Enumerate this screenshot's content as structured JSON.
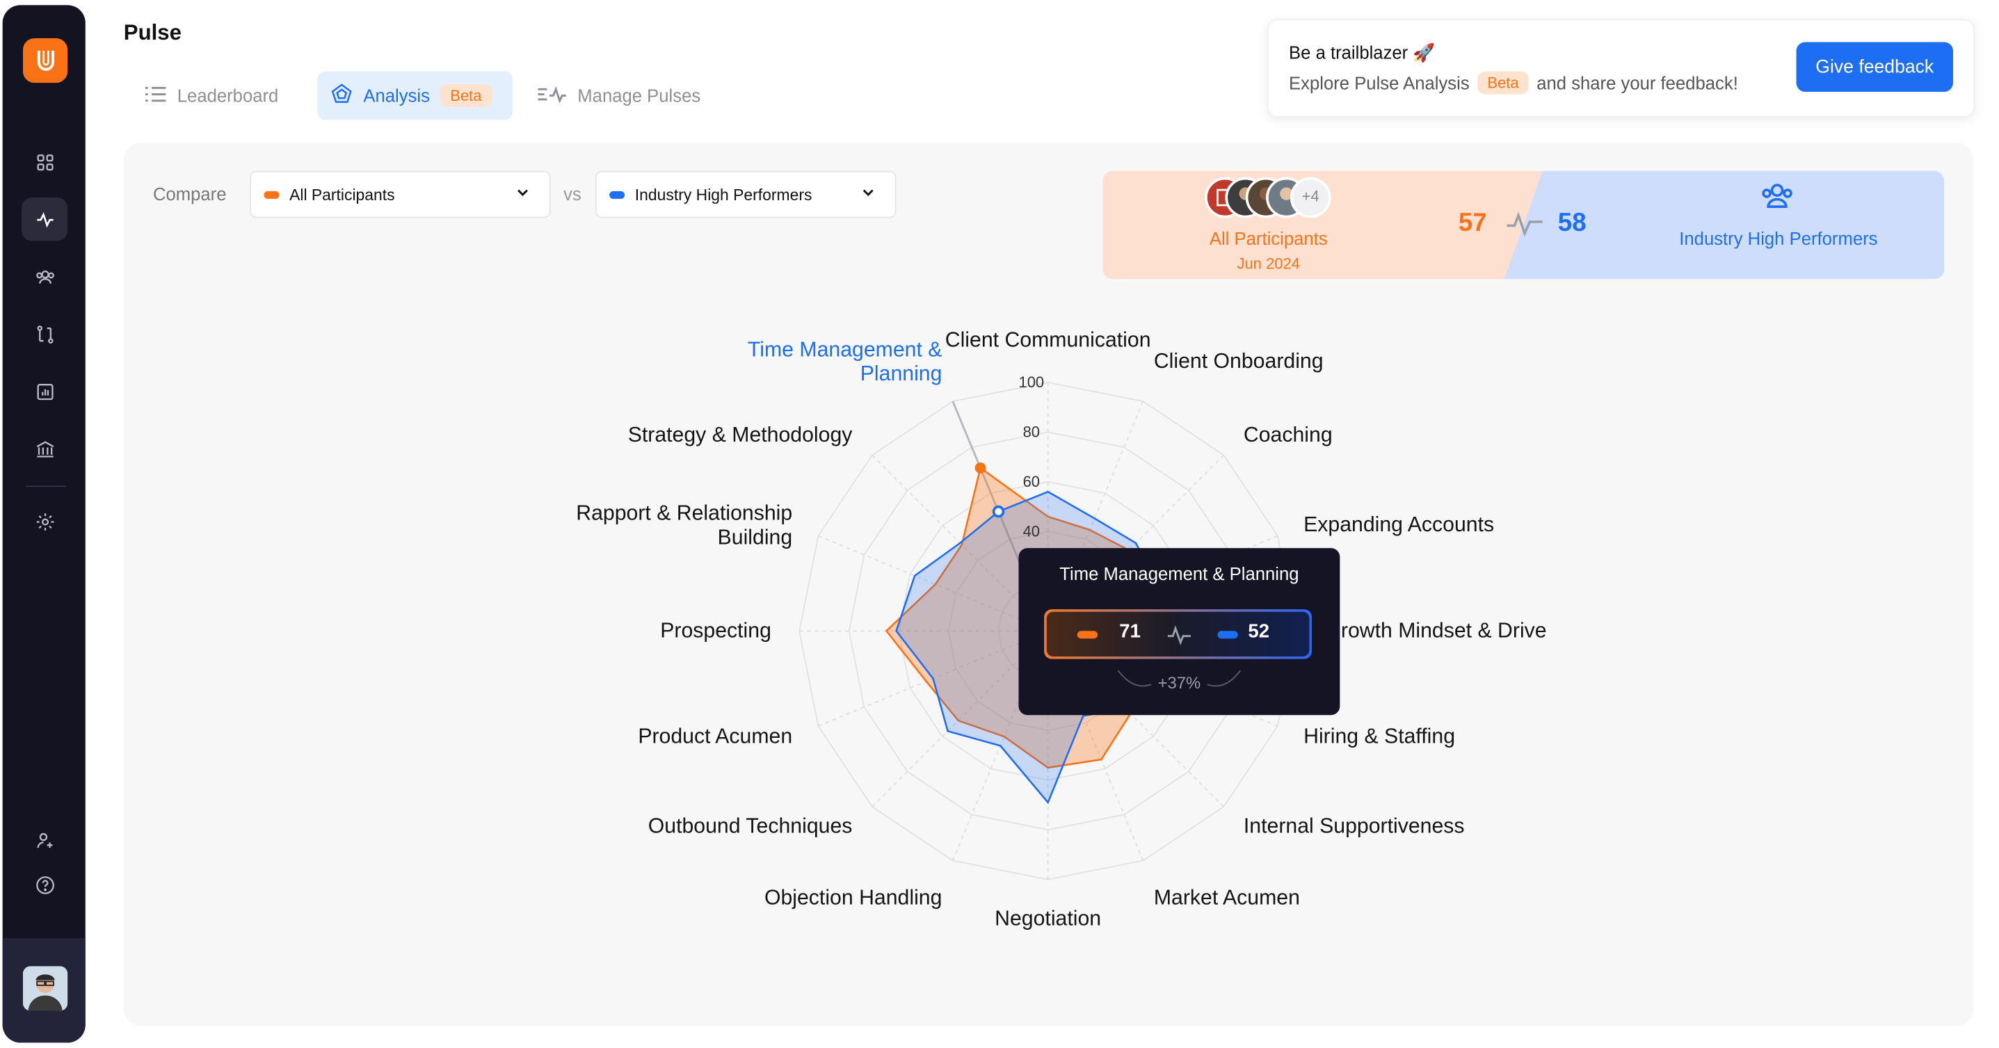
{
  "page": {
    "title": "Pulse"
  },
  "sidebar": {
    "icons": [
      "logo-icon",
      "grid-icon",
      "pulse-icon",
      "people-icon",
      "route-icon",
      "chart-icon",
      "bank-icon",
      "gear-icon",
      "add-user-icon",
      "help-icon"
    ],
    "active": "pulse-icon"
  },
  "tabs": [
    {
      "label": "Leaderboard",
      "icon": "list-icon",
      "active": false
    },
    {
      "label": "Analysis",
      "icon": "radar-icon",
      "active": true,
      "badge": "Beta"
    },
    {
      "label": "Manage Pulses",
      "icon": "pulse-edit-icon",
      "active": false
    }
  ],
  "feedback": {
    "title": "Be a trailblazer 🚀",
    "sub_before": "Explore Pulse Analysis",
    "badge": "Beta",
    "sub_after": "and share your feedback!",
    "button": "Give feedback"
  },
  "compare": {
    "label": "Compare",
    "vs": "vs",
    "left_select": "All Participants",
    "right_select": "Industry High Performers"
  },
  "summary": {
    "left_name": "All Participants",
    "left_date": "Jun 2024",
    "left_score": "57",
    "right_score": "58",
    "right_name": "Industry High Performers",
    "more_avatars": "+4"
  },
  "tooltip": {
    "title": "Time Management & Planning",
    "left_value": "71",
    "right_value": "52",
    "change": "+37%"
  },
  "colors": {
    "orange": "#f97316",
    "blue": "#1d6ef2",
    "dark": "#131321"
  },
  "chart_data": {
    "type": "radar",
    "axes": [
      "Client Communication",
      "Client Onboarding",
      "Coaching",
      "Expanding Accounts",
      "Growth Mindset & Drive",
      "Hiring & Staffing",
      "Internal Supportiveness",
      "Market Acumen",
      "Negotiation",
      "Objection Handling",
      "Outbound Techniques",
      "Product Acumen",
      "Prospecting",
      "Rapport & Relationship Building",
      "Strategy & Methodology",
      "Time Management & Planning"
    ],
    "highlighted_axis": "Time Management & Planning",
    "ticks": [
      40,
      60,
      80,
      100
    ],
    "range": [
      0,
      100
    ],
    "series": [
      {
        "name": "All Participants",
        "color": "#f97316",
        "values": [
          46,
          44,
          46,
          38,
          38,
          35,
          47,
          56,
          55,
          46,
          51,
          53,
          65,
          49,
          49,
          71
        ]
      },
      {
        "name": "Industry High Performers",
        "color": "#1d6ef2",
        "values": [
          56,
          49,
          50,
          48,
          45,
          47,
          44,
          37,
          69,
          50,
          57,
          50,
          61,
          58,
          50,
          52
        ]
      }
    ]
  }
}
